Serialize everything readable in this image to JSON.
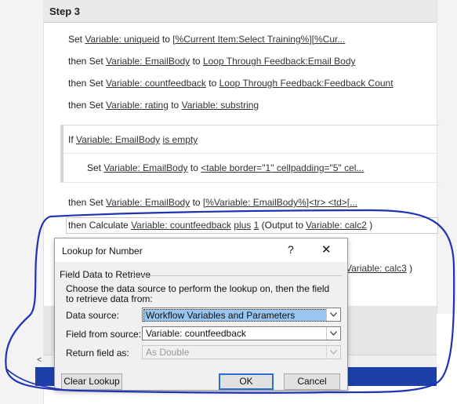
{
  "step": {
    "title": "Step 3"
  },
  "workflow": {
    "lines": [
      {
        "prefix": "Set",
        "var": "Variable: uniqueid",
        "mid": "to",
        "value": "[%Current Item:Select Training%][%Cur..."
      },
      {
        "prefix": "then Set",
        "var": "Variable: EmailBody",
        "mid": "to",
        "value": "Loop Through Feedback:Email Body"
      },
      {
        "prefix": "then Set",
        "var": "Variable: countfeedback",
        "mid": "to",
        "value": "Loop Through Feedback:Feedback Count"
      },
      {
        "prefix": "then Set",
        "var": "Variable: rating",
        "mid": "to",
        "value": "Variable: substring"
      }
    ],
    "condition": {
      "prefix": "If",
      "var": "Variable: EmailBody",
      "op": "is empty"
    },
    "cond_action": {
      "prefix": "Set",
      "var": "Variable: EmailBody",
      "mid": "to",
      "value": "<table border=\"1\" cellpadding=\"5\" cel..."
    },
    "after": {
      "prefix": "then Set",
      "var": "Variable: EmailBody",
      "mid": "to",
      "value": "[%Variable: EmailBody%]<tr>    <td>[..."
    },
    "calc": {
      "prefix": "then Calculate",
      "var": "Variable: countfeedback",
      "op": "plus",
      "num": "1",
      "out_prefix": "(Output to",
      "out_var": "Variable: calc2",
      "out_suffix": ")"
    },
    "hidden_partial": {
      "var": "Variable: calc3",
      "suffix": ")"
    },
    "scroll_arrow": "<"
  },
  "dialog": {
    "title": "Lookup for Number",
    "help": "?",
    "close": "✕",
    "group_title": "Field Data to Retrieve",
    "description": "Choose the data source to perform the lookup on, then the field to retrieve data from:",
    "fields": {
      "data_source_label": "Data source:",
      "data_source_value": "Workflow Variables and Parameters",
      "field_label": "Field from source:",
      "field_value": "Variable: countfeedback",
      "return_label": "Return field as:",
      "return_value": "As Double"
    },
    "buttons": {
      "clear": "Clear Lookup",
      "ok": "OK",
      "cancel": "Cancel"
    }
  },
  "colors": {
    "annotation": "#1f33b5",
    "selection": "#99c6f0",
    "taskbar": "#1e3fa8"
  },
  "icons": [
    "chevron-down-icon",
    "close-icon",
    "help-icon"
  ]
}
